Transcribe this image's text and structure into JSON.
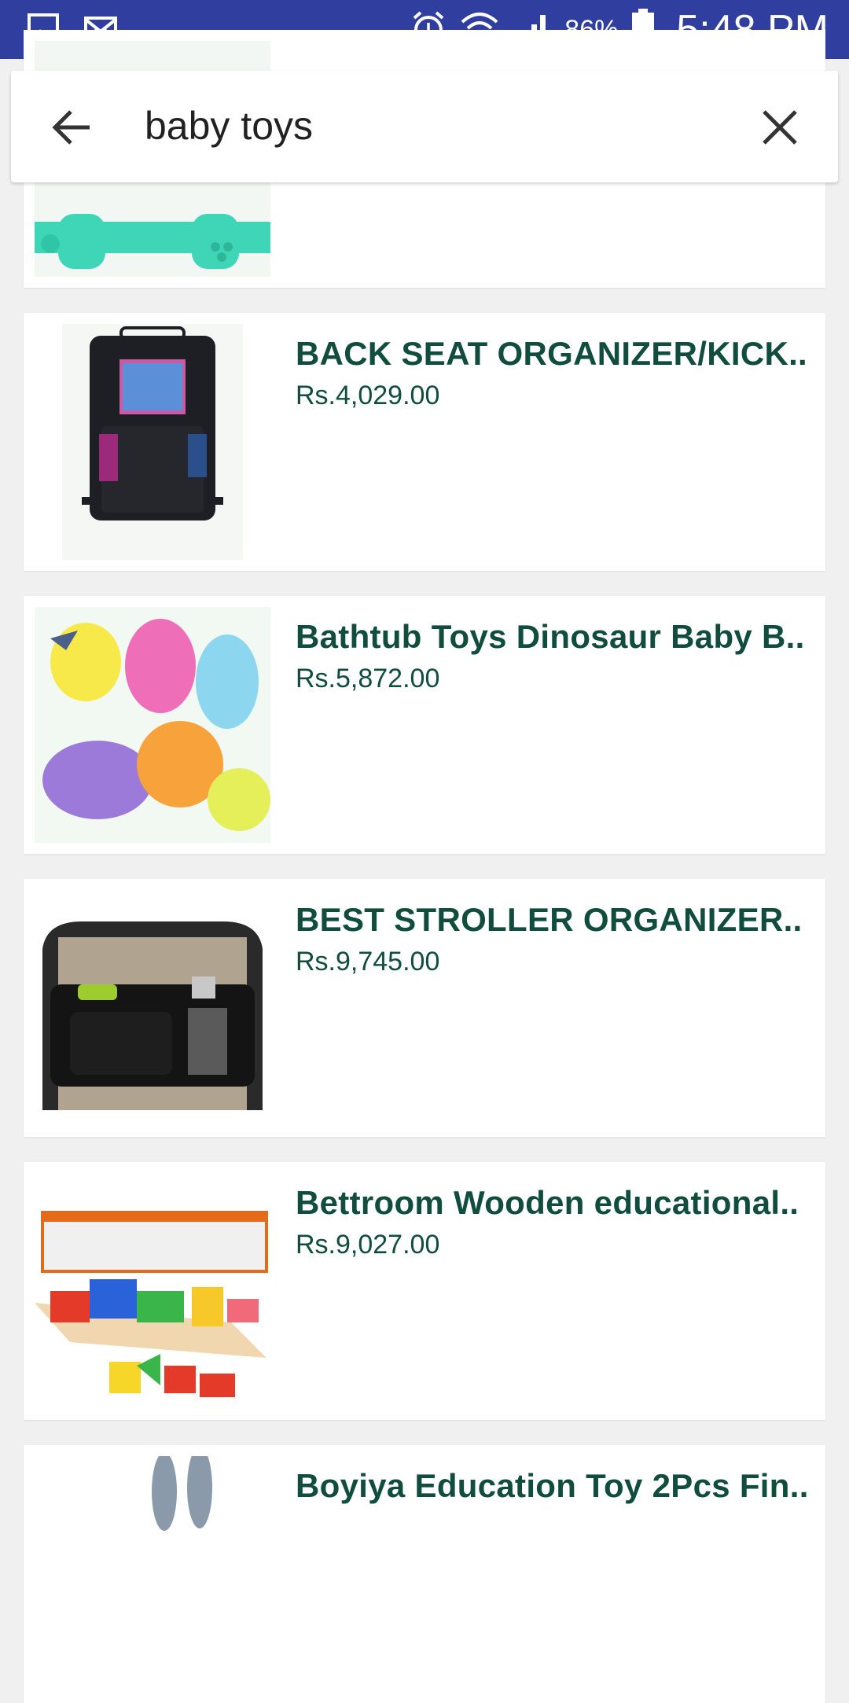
{
  "status_bar": {
    "battery_percent": "86%",
    "time": "5:48 PM",
    "left_icons": [
      "gallery-icon",
      "email-icon"
    ],
    "right_icons": [
      "alarm-icon",
      "wifi-icon",
      "signal-icon",
      "battery-icon"
    ]
  },
  "search": {
    "query": "baby toys",
    "back_icon": "arrow-left-icon",
    "clear_icon": "close-icon"
  },
  "results": [
    {
      "title": "",
      "price": "",
      "image": "teether-toy"
    },
    {
      "title": "BACK SEAT ORGANIZER/KICK..",
      "price": "Rs.4,029.00",
      "image": "back-seat-organizer"
    },
    {
      "title": "Bathtub Toys Dinosaur Baby B..",
      "price": "Rs.5,872.00",
      "image": "bathtub-dinosaurs"
    },
    {
      "title": "BEST STROLLER ORGANIZER..",
      "price": "Rs.9,745.00",
      "image": "stroller-organizer"
    },
    {
      "title": "Bettroom Wooden educational..",
      "price": "Rs.9,027.00",
      "image": "wooden-shape-sorter"
    },
    {
      "title": "Boyiya Education Toy 2Pcs Fin..",
      "price": "",
      "image": "plush-bunny"
    }
  ],
  "colors": {
    "status_bar": "#303f9f",
    "title_text": "#114d3c",
    "background": "#f0f0f0",
    "card": "#ffffff"
  }
}
